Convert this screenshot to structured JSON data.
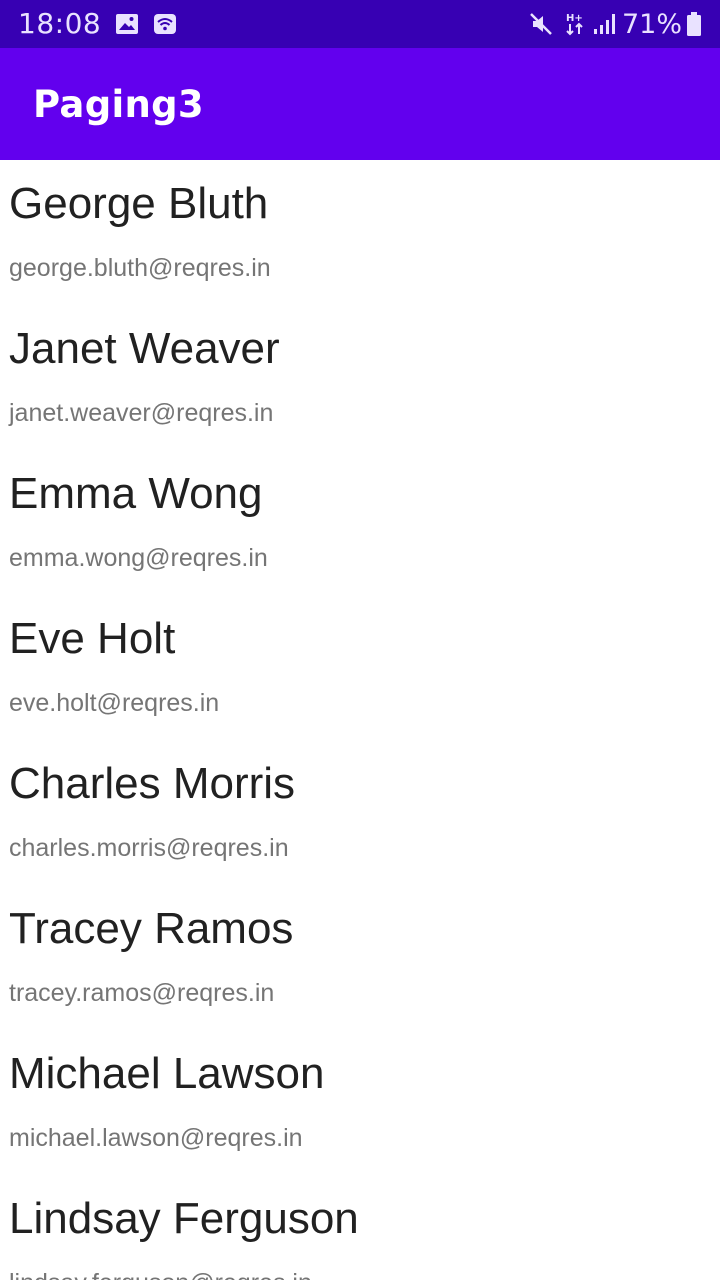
{
  "status_bar": {
    "time": "18:08",
    "battery": "71%",
    "icons": [
      "image-icon",
      "wifi-hotspot-icon",
      "mute-icon",
      "data-transfer-icon",
      "signal-icon",
      "battery-icon"
    ],
    "color": "#3700b3"
  },
  "app_bar": {
    "title": "Paging3",
    "color": "#6200ee"
  },
  "users": [
    {
      "name": "George Bluth",
      "email": "george.bluth@reqres.in"
    },
    {
      "name": "Janet Weaver",
      "email": "janet.weaver@reqres.in"
    },
    {
      "name": "Emma Wong",
      "email": "emma.wong@reqres.in"
    },
    {
      "name": "Eve Holt",
      "email": "eve.holt@reqres.in"
    },
    {
      "name": "Charles Morris",
      "email": "charles.morris@reqres.in"
    },
    {
      "name": "Tracey Ramos",
      "email": "tracey.ramos@reqres.in"
    },
    {
      "name": "Michael Lawson",
      "email": "michael.lawson@reqres.in"
    },
    {
      "name": "Lindsay Ferguson",
      "email": "lindsay.ferguson@reqres.in"
    }
  ]
}
